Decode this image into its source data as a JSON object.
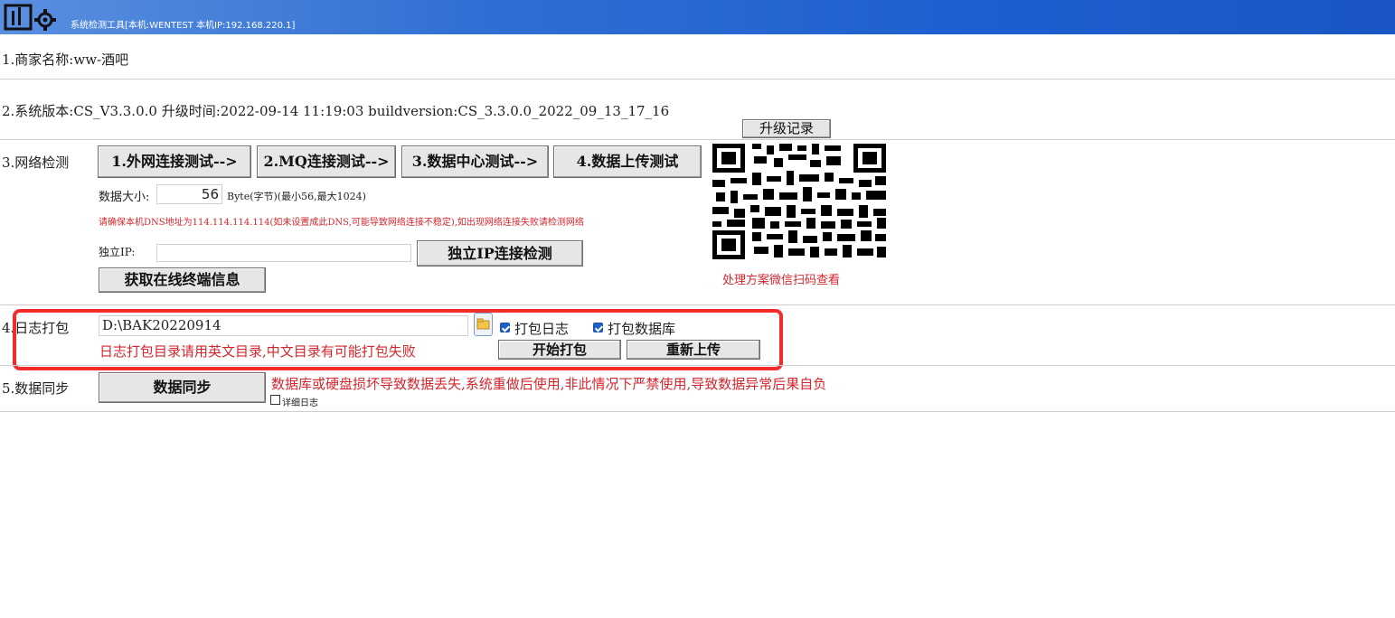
{
  "window": {
    "title": "系统检测工具[本机:WENTEST 本机IP:192.168.220.1]"
  },
  "merchant": {
    "label": "1.商家名称:ww-酒吧"
  },
  "version": {
    "label": "2.系统版本:CS_V3.3.0.0 升级时间:2022-09-14 11:19:03 buildversion:CS_3.3.0.0_2022_09_13_17_16",
    "upgrade_record_button": "升级记录"
  },
  "network": {
    "label": "3.网络检测",
    "tests": [
      "1.外网连接测试-->",
      "2.MQ连接测试-->",
      "3.数据中心测试-->",
      "4.数据上传测试"
    ],
    "data_size_label": "数据大小:",
    "data_size_value": "56",
    "data_size_unit": "Byte(字节)(最小56,最大1024)",
    "dns_warning": "请确保本机DNS地址为114.114.114.114(如未设置成此DNS,可能导致网络连接不稳定),如出现网络连接失败请检测网络",
    "ip_label": "独立IP:",
    "ip_value": "",
    "ip_check_button": "独立IP连接检测",
    "online_terminal_button": "获取在线终端信息",
    "qr_caption": "处理方案微信扫码查看"
  },
  "log_pack": {
    "label": "4.日志打包",
    "path": "D:\\BAK20220914",
    "pack_log_label": "打包日志",
    "pack_db_label": "打包数据库",
    "warning": "日志打包目录请用英文目录,中文目录有可能打包失败",
    "start_button": "开始打包",
    "reupload_button": "重新上传"
  },
  "data_sync": {
    "label": "5.数据同步",
    "button": "数据同步",
    "warning": "数据库或硬盘损坏导致数据丢失,系统重做后使用,非此情况下严禁使用,导致数据异常后果自负",
    "detail_log_label": "详细日志"
  },
  "colors": {
    "accent": "#1d5fcf",
    "warning": "#d4262c",
    "highlight": "#f02c2c"
  }
}
